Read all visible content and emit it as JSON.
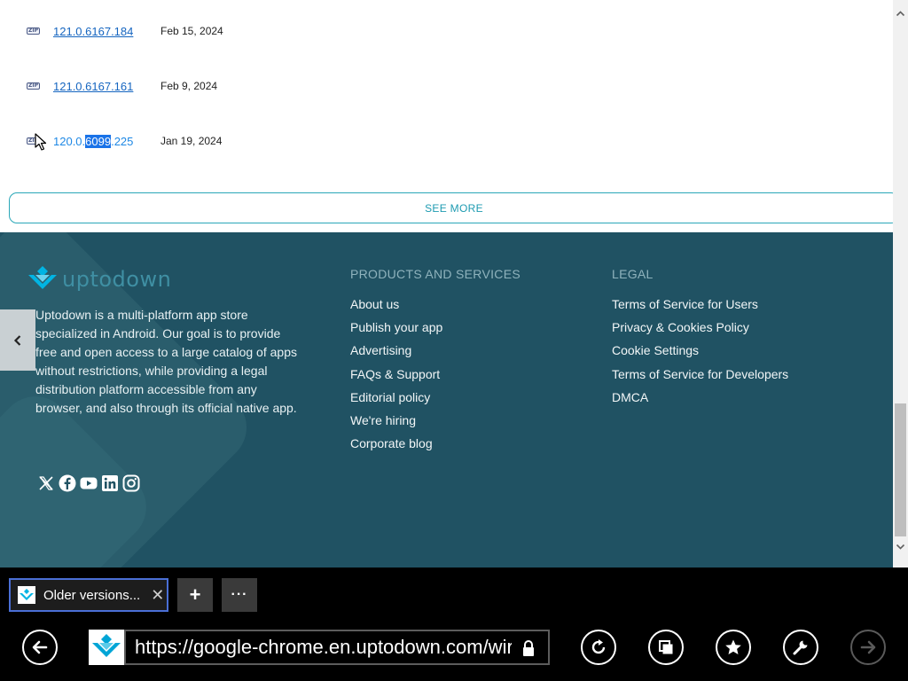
{
  "versions": [
    {
      "icon": "zip-file-icon",
      "icon_text": "ZIP",
      "version": "121.0.6167.184",
      "date": "Feb 15, 2024"
    },
    {
      "icon": "zip-file-icon",
      "icon_text": "ZIP",
      "version": "121.0.6167.161",
      "date": "Feb 9, 2024"
    },
    {
      "icon": "zip-file-icon",
      "icon_text": "ZIP",
      "version_parts": [
        "120.0.",
        "6099",
        ".225"
      ],
      "date": "Jan 19, 2024"
    }
  ],
  "see_more_label": "SEE MORE",
  "footer": {
    "logo_text": "uptodown",
    "about": "Uptodown is a multi-platform app store specialized in Android. Our goal is to provide free and open access to a large catalog of apps without restrictions, while providing a legal distribution platform accessible from any browser, and also through its official native app.",
    "social_icons": [
      "x-icon",
      "facebook-icon",
      "youtube-icon",
      "linkedin-icon",
      "instagram-icon"
    ],
    "products": {
      "title": "PRODUCTS AND SERVICES",
      "items": [
        "About us",
        "Publish your app",
        "Advertising",
        "FAQs & Support",
        "Editorial policy",
        "We're hiring",
        "Corporate blog"
      ]
    },
    "legal": {
      "title": "LEGAL",
      "items": [
        "Terms of Service for Users",
        "Privacy & Cookies Policy",
        "Cookie Settings",
        "Terms of Service for Developers",
        "DMCA"
      ]
    }
  },
  "browser": {
    "tab_title": "Older versions...",
    "tab_close": "✕",
    "new_tab": "+",
    "more_tabs": "···",
    "url": "https://google-chrome.en.uptodown.com/wir"
  },
  "colors": {
    "link": "#1565c0",
    "accent": "#1e9bb1",
    "footer_bg": "#205263",
    "tab_border": "#4a6fd6"
  }
}
